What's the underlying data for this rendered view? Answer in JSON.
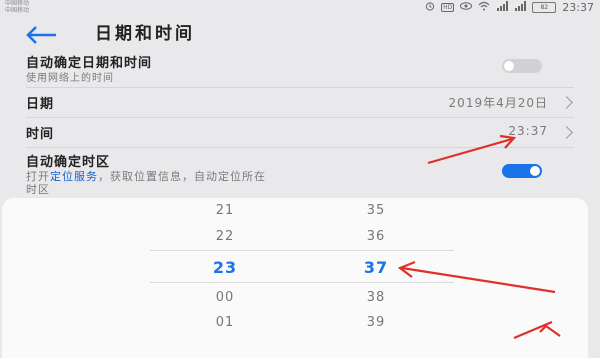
{
  "status_bar": {
    "carrier_line1": "中国移动",
    "carrier_line2": "中国移动",
    "icons": [
      "alarm-icon",
      "hd-icon",
      "eye-icon",
      "wifi-icon",
      "signal-icon",
      "signal-4g-icon"
    ],
    "hd_label": "HD",
    "battery": "82",
    "time": "23:37"
  },
  "header": {
    "title": "日期和时间",
    "back_icon": "back-arrow-icon"
  },
  "settings": {
    "auto_datetime": {
      "title": "自动确定日期和时间",
      "subtitle": "使用网络上的时间",
      "enabled": false
    },
    "date": {
      "label": "日期",
      "value": "2019年4月20日"
    },
    "time": {
      "label": "时间",
      "value": "23:37"
    },
    "auto_timezone": {
      "title": "自动确定时区",
      "desc_prefix": "打开",
      "desc_link": "定位服务",
      "desc_suffix": "，获取位置信息，自动定位所在",
      "desc_line2": "时区",
      "enabled": true
    }
  },
  "time_picker": {
    "hours": [
      "21",
      "22",
      "23",
      "00",
      "01"
    ],
    "minutes": [
      "35",
      "36",
      "37",
      "38",
      "39"
    ],
    "selected_hour": "23",
    "selected_minute": "37"
  },
  "colors": {
    "accent": "#1a73e8",
    "annotation": "#e0302a",
    "background": "#e9e9ec"
  }
}
